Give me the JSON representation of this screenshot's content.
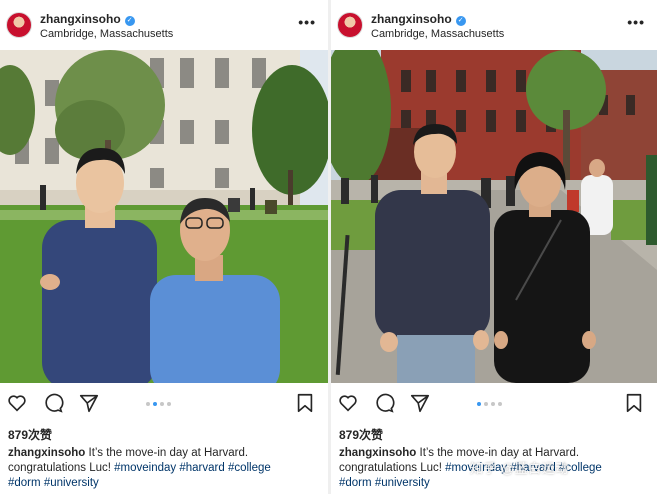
{
  "posts": [
    {
      "username": "zhangxinsoho",
      "location": "Cambridge, Massachusetts",
      "more_icon": "more-dots-icon",
      "likes": "879次赞",
      "caption": {
        "username": "zhangxinsoho",
        "line1": "It’s the move-in day at Harvard.",
        "line2": "congratulations Luc!",
        "tags_line2": [
          "#moveinday",
          "#harvard",
          "#college"
        ],
        "tags_line3": [
          "#dorm",
          "#university"
        ]
      },
      "carousel": {
        "count": 4,
        "active": 2
      }
    },
    {
      "username": "zhangxinsoho",
      "location": "Cambridge, Massachusetts",
      "more_icon": "more-dots-icon",
      "likes": "879次赞",
      "caption": {
        "username": "zhangxinsoho",
        "line1": "It’s the move-in day at Harvard.",
        "line2": "congratulations Luc!",
        "tags_line2": [
          "#moveinday",
          "#harvard",
          "#college"
        ],
        "tags_line3": [
          "#dorm",
          "#university"
        ]
      },
      "carousel": {
        "count": 4,
        "active": 1
      }
    }
  ],
  "icons": [
    "heart-icon",
    "comment-icon",
    "share-icon",
    "bookmark-icon"
  ],
  "watermark": "知乎 @蓝白运动",
  "colors": {
    "link": "#003569",
    "dot_active": "#3897f0",
    "verified": "#3897f0"
  }
}
